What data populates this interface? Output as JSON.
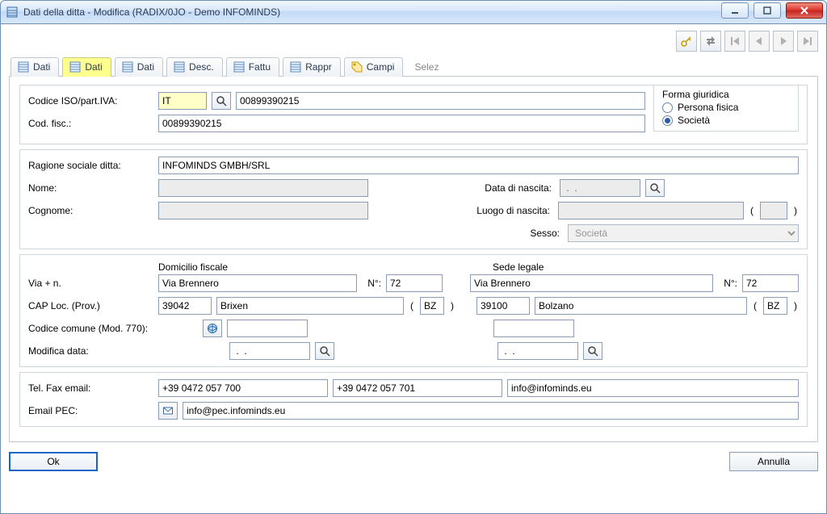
{
  "window": {
    "title": "Dati della ditta - Modifica (RADIX/0JO - Demo INFOMINDS)"
  },
  "tabs": {
    "t1": "Dati",
    "t2": "Dati",
    "t3": "Dati",
    "t4": "Desc.",
    "t5": "Fattu",
    "t6": "Rappr",
    "t7": "Campi",
    "selez": "Selez"
  },
  "toolbar": {
    "key": "key-icon",
    "swap": "swap-icon"
  },
  "labels": {
    "codice_iso": "Codice ISO/part.IVA:",
    "cod_fisc": "Cod. fisc.:",
    "forma_giuridica": "Forma giuridica",
    "persona_fisica": "Persona fisica",
    "societa": "Società",
    "ragione_sociale": "Ragione sociale ditta:",
    "nome": "Nome:",
    "cognome": "Cognome:",
    "data_nascita": "Data di nascita:",
    "luogo_nascita": "Luogo di nascita:",
    "sesso": "Sesso:",
    "domicilio_fiscale": "Domicilio fiscale",
    "sede_legale": "Sede legale",
    "via_n": "Via + n.",
    "numero": "N°:",
    "cap_loc_prov": "CAP Loc. (Prov.)",
    "codice_comune": "Codice comune (Mod. 770):",
    "modifica_data": "Modifica data:",
    "tel_fax_email": "Tel. Fax email:",
    "email_pec": "Email PEC:"
  },
  "values": {
    "iso": "IT",
    "piva": "00899390215",
    "cod_fisc": "00899390215",
    "ragione_sociale": "INFOMINDS GMBH/SRL",
    "nome": "",
    "cognome": "",
    "data_nascita": " .  . ",
    "luogo_nascita": "",
    "luogo_nascita_prov": "",
    "sesso": "Società",
    "dom_via": "Via Brennero",
    "dom_num": "72",
    "dom_cap": "39042",
    "dom_loc": "Brixen",
    "dom_prov": "BZ",
    "leg_via": "Via Brennero",
    "leg_num": "72",
    "leg_cap": "39100",
    "leg_loc": "Bolzano",
    "leg_prov": "BZ",
    "cod_comune_dom": "",
    "cod_comune_leg": "",
    "mod_data_dom": " .  . ",
    "mod_data_leg": " .  . ",
    "tel": "+39 0472 057 700",
    "fax": "+39 0472 057 701",
    "email": "info@infominds.eu",
    "email_pec": "info@pec.infominds.eu"
  },
  "buttons": {
    "ok": "Ok",
    "annulla": "Annulla"
  }
}
